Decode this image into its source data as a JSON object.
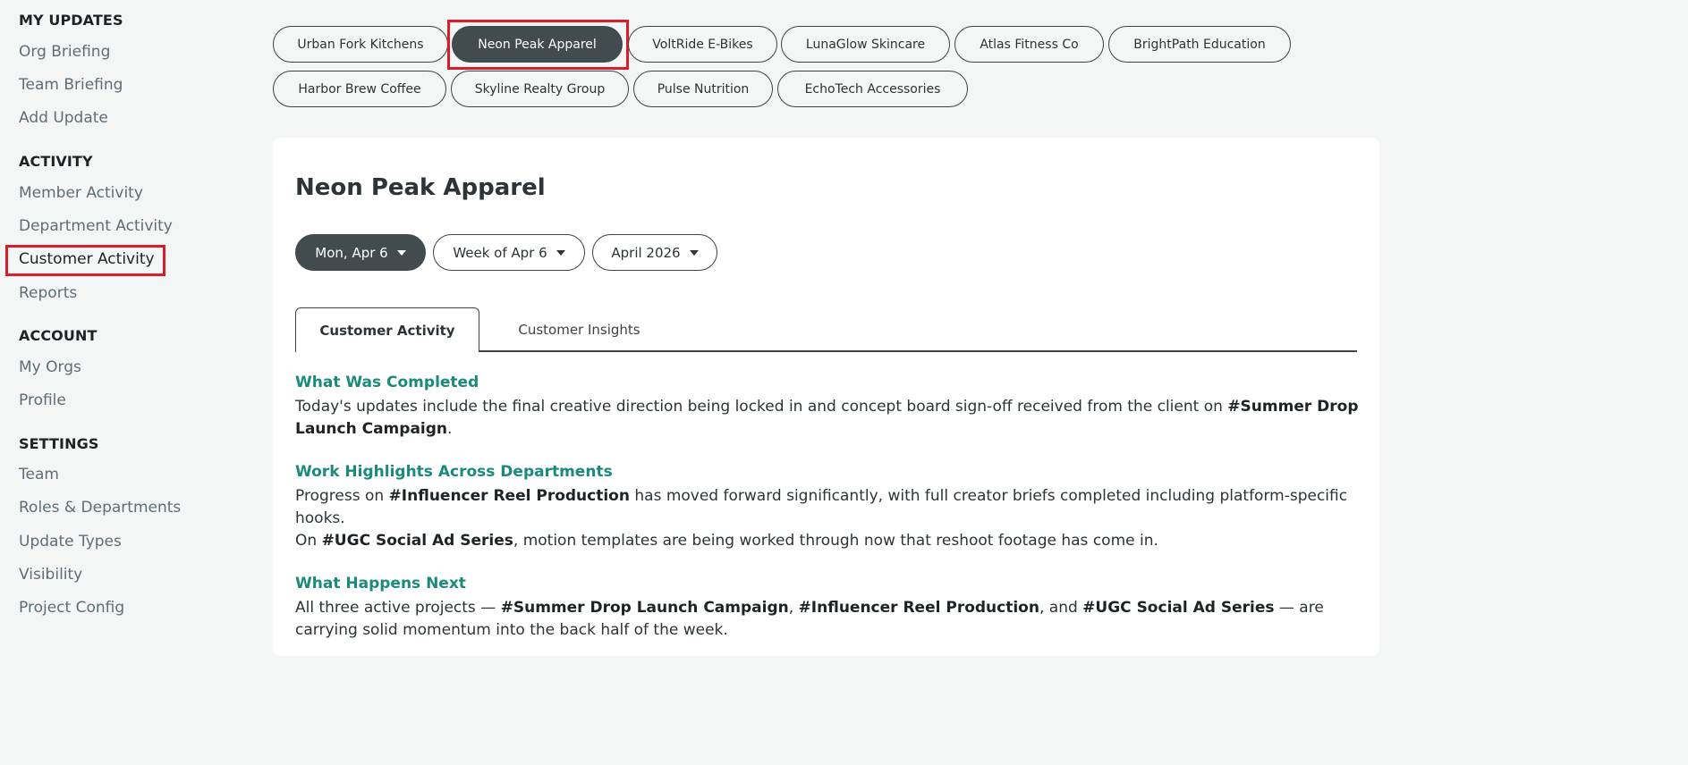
{
  "sidebar": {
    "sections": [
      {
        "title": "MY UPDATES",
        "items": [
          "Org Briefing",
          "Team Briefing",
          "Add Update"
        ]
      },
      {
        "title": "ACTIVITY",
        "items": [
          "Member Activity",
          "Department Activity",
          "Customer Activity",
          "Reports"
        ]
      },
      {
        "title": "ACCOUNT",
        "items": [
          "My Orgs",
          "Profile"
        ]
      },
      {
        "title": "SETTINGS",
        "items": [
          "Team",
          "Roles & Departments",
          "Update Types",
          "Visibility",
          "Project Config"
        ]
      }
    ],
    "active_item": "Customer Activity"
  },
  "customers": {
    "chips": [
      "Urban Fork Kitchens",
      "Neon Peak Apparel",
      "VoltRide E-Bikes",
      "LunaGlow Skincare",
      "Atlas Fitness Co",
      "BrightPath Education",
      "Harbor Brew Coffee",
      "Skyline Realty Group",
      "Pulse Nutrition",
      "EchoTech Accessories"
    ],
    "selected": "Neon Peak Apparel"
  },
  "main": {
    "title": "Neon Peak Apparel",
    "filters": {
      "day": "Mon, Apr 6",
      "week": "Week of Apr 6",
      "month": "April 2026"
    },
    "tabs": {
      "active": "Customer Activity",
      "other": "Customer Insights"
    },
    "sections": {
      "completed": {
        "heading": "What Was Completed",
        "p1_a": "Today's updates include the final creative direction being locked in and concept board sign-off received from the client on ",
        "p1_tag": "#Summer Drop Launch Campaign",
        "p1_b": "."
      },
      "highlights": {
        "heading": "Work Highlights Across Departments",
        "p1_a": "Progress on ",
        "p1_tag": "#Influencer Reel Production",
        "p1_b": " has moved forward significantly, with full creator briefs completed including platform-specific hooks.",
        "p2_a": "On ",
        "p2_tag": "#UGC Social Ad Series",
        "p2_b": ", motion templates are being worked through now that reshoot footage has come in."
      },
      "next": {
        "heading": "What Happens Next",
        "p1_a": "All three active projects — ",
        "p1_tag1": "#Summer Drop Launch Campaign",
        "p1_sep1": ", ",
        "p1_tag2": "#Influencer Reel Production",
        "p1_sep2": ", and ",
        "p1_tag3": "#UGC Social Ad Series",
        "p1_b": " — are carrying solid momentum into the back half of the week."
      }
    }
  },
  "colors": {
    "accent_teal": "#1a8a7a",
    "chip_active": "#424b50",
    "highlight_red": "#dd1c2b"
  }
}
